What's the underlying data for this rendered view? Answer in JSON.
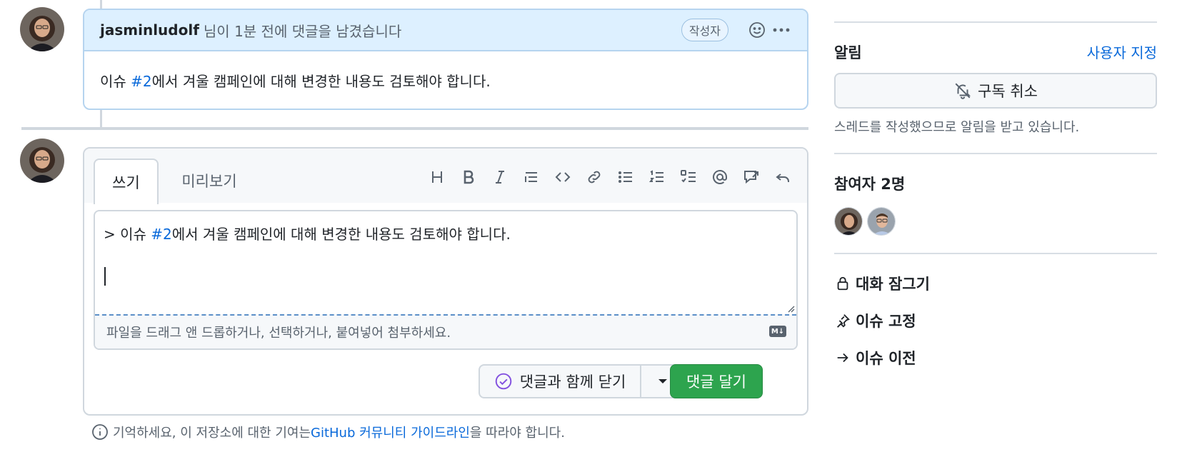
{
  "comment": {
    "author": "jasminludolf",
    "meta": "님이 1분 전에 댓글을 남겼습니다",
    "author_badge": "작성자",
    "body_prefix": "이슈 ",
    "body_link": "#2",
    "body_suffix": "에서 겨울 캠페인에 대해 변경한 내용도 검토해야 합니다."
  },
  "compose": {
    "tab_write": "쓰기",
    "tab_preview": "미리보기",
    "toolbar_icons": [
      "heading-icon",
      "bold-icon",
      "italic-icon",
      "quote-icon",
      "code-icon",
      "link-icon",
      "unordered-list-icon",
      "ordered-list-icon",
      "task-list-icon",
      "mention-icon",
      "reference-icon",
      "reply-icon"
    ],
    "editor_prefix": "> 이슈 ",
    "editor_link": "#2",
    "editor_suffix": "에서 겨울 캠페인에 대해 변경한 내용도 검토해야 합니다.",
    "attach_hint": "파일을 드래그 앤 드롭하거나, 선택하거나, 붙여넣어 첨부하세요.",
    "markdown_badge": "M↓",
    "close_with_comment": "댓글과 함께 닫기",
    "submit": "댓글 달기"
  },
  "guidelines": {
    "prefix": "기억하세요, 이 저장소에 대한 기여는 ",
    "link": "GitHub 커뮤니티 가이드라인",
    "suffix": "을 따라야 합니다."
  },
  "sidebar": {
    "notifications_heading": "알림",
    "customize_link": "사용자 지정",
    "unsubscribe_label": "구독 취소",
    "notification_note": "스레드를 작성했으므로 알림을 받고 있습니다.",
    "participants_heading": "참여자 2명",
    "lock_label": "대화 잠그기",
    "pin_label": "이슈 고정",
    "transfer_label": "이슈 이전"
  },
  "colors": {
    "accent_link": "#0969da",
    "primary_button": "#2da44e",
    "comment_header_bg": "#ddf0ff",
    "close_icon": "#8250df"
  }
}
